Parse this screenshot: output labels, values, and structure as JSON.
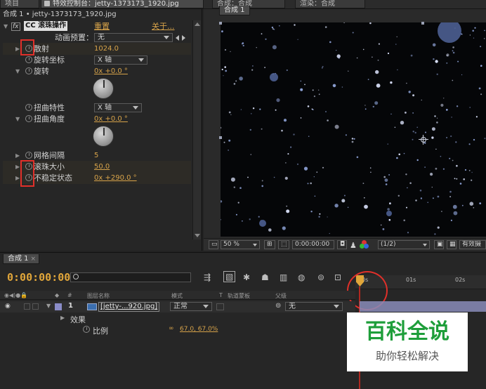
{
  "top_tabs": {
    "project": "项目",
    "effect_controls": "特效控制台：jetty-1373173_1920.jpg",
    "comp_viewer_a": "合成：合成",
    "comp_viewer_b": "渲染：合成"
  },
  "effect_panel": {
    "breadcrumb": "合成 1 • jetty-1373173_1920.jpg",
    "fx_label": "fx",
    "effect_name": "CC 滚珠操作",
    "reset": "重置",
    "about": "关于...",
    "preset_label": "动画预置：",
    "preset_value": "无",
    "props": [
      {
        "name": "散射",
        "value": "1024.0"
      },
      {
        "name": "旋转坐标",
        "value": "X 轴"
      },
      {
        "name": "旋转",
        "value": "0x +0.0 °"
      },
      {
        "name": "扭曲特性",
        "value": "X 轴"
      },
      {
        "name": "扭曲角度",
        "value": "0x +0.0 °"
      },
      {
        "name": "网格间隔",
        "value": "5"
      },
      {
        "name": "滚珠大小",
        "value": "50.0"
      },
      {
        "name": "不稳定状态",
        "value": "0x +290.0 °"
      }
    ]
  },
  "viewer": {
    "comp_tab": "合成 1",
    "zoom": "50 %",
    "timecode": "0:00:00:00",
    "resolution": "(1/2)",
    "camera": "有效摄"
  },
  "timeline": {
    "tab": "合成 1",
    "timecode": "0:00:00:00",
    "search_placeholder": "",
    "ruler_marks": [
      "0s",
      "01s",
      "02s"
    ],
    "columns": {
      "hash": "#",
      "source_name": "图层名称",
      "mode": "模式",
      "t": "T",
      "trkmat": "轨道蒙板",
      "parent": "父级"
    },
    "layer": {
      "index": "1",
      "name": "[jetty-...920.jpg]",
      "mode": "正常",
      "parent": "无"
    },
    "effects_label": "效果",
    "scale_label": "比例",
    "scale_value": "67.0, 67.0%"
  },
  "watermark": {
    "title": "百科全说",
    "subtitle": "助你轻松解决"
  },
  "colors": {
    "panel_bg": "#232323",
    "value_orange": "#d7a34a",
    "timecode_orange": "#e1a63a",
    "highlight_red": "#e0302a",
    "watermark_green": "#1e9e3a"
  }
}
